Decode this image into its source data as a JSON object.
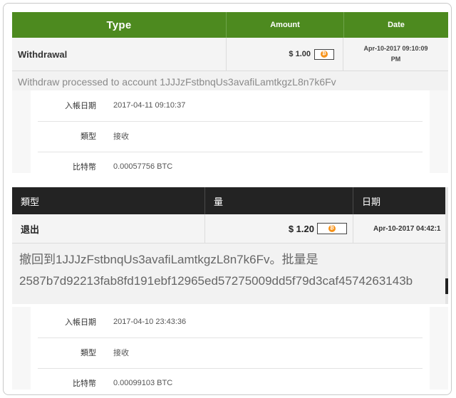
{
  "block1": {
    "header": {
      "type": "Type",
      "amount": "Amount",
      "date": "Date"
    },
    "row": {
      "type": "Withdrawal",
      "amount": "$ 1.00",
      "date_line1": "Apr-10-2017 09:10:09",
      "date_line2": "PM"
    },
    "note": "Withdraw processed to account 1JJJzFstbnqUs3avafiLamtkgzL8n7k6Fv"
  },
  "details1": [
    {
      "label": "入帳日期",
      "value": "2017-04-11 09:10:37"
    },
    {
      "label": "類型",
      "value": "接收"
    },
    {
      "label": "比特幣",
      "value": "0.00057756 BTC"
    }
  ],
  "block2": {
    "header": {
      "type": "類型",
      "amount": "量",
      "date": "日期"
    },
    "row": {
      "type": "退出",
      "amount": "$ 1.20",
      "date": "Apr-10-2017 04:42:1"
    },
    "note_line1": "撤回到1JJJzFstbnqUs3avafiLamtkgzL8n7k6Fv。批量是",
    "note_line2": "2587b7d92213fab8fd191ebf12965ed57275009dd5f79d3caf4574263143b"
  },
  "details2": [
    {
      "label": "入帳日期",
      "value": "2017-04-10 23:43:36"
    },
    {
      "label": "類型",
      "value": "接收"
    },
    {
      "label": "比特幣",
      "value": "0.00099103 BTC"
    }
  ],
  "icons": {
    "coin": "bitcoin-coin-icon",
    "coin_glyph": "₿"
  },
  "colors": {
    "green_header": "#4d8a1f",
    "dark_header": "#232323",
    "bitcoin_orange": "#f7931a"
  }
}
